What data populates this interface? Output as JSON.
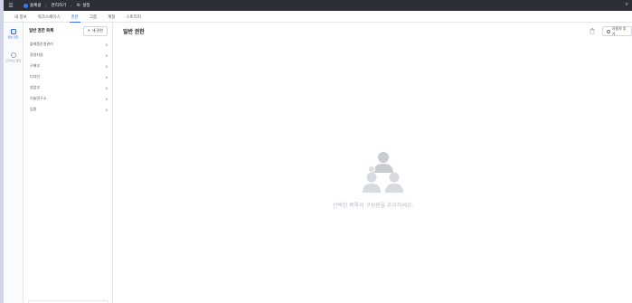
{
  "topbar": {
    "menu_icon": "hamburger-icon",
    "app_name": "올체클",
    "breadcrumb": [
      "관리하기",
      "설정"
    ],
    "right_icon": "search-icon"
  },
  "tabs": [
    {
      "label": "내 정보",
      "active": false
    },
    {
      "label": "워크스페이스",
      "active": false
    },
    {
      "label": "권한",
      "active": true
    },
    {
      "label": "그룹",
      "active": false
    },
    {
      "label": "계정",
      "active": false
    },
    {
      "label": "스토리지",
      "active": false
    }
  ],
  "rail": [
    {
      "label": "일반 권한",
      "icon": "user-shield-icon",
      "active": true
    },
    {
      "label": "드라이브 권한",
      "icon": "drive-icon",
      "active": false
    }
  ],
  "list_panel": {
    "title": "일반 권한 목록",
    "new_button": "새 권한",
    "items": [
      {
        "label": "플래폼운영관리",
        "count": "0"
      },
      {
        "label": "경영지원",
        "count": "0"
      },
      {
        "label": "구매부",
        "count": "0"
      },
      {
        "label": "디자인",
        "count": "0"
      },
      {
        "label": "영업부",
        "count": "0"
      },
      {
        "label": "기술연구소",
        "count": "0"
      },
      {
        "label": "임원",
        "count": "0"
      }
    ]
  },
  "main": {
    "title": "일반 권한",
    "add_user_button": "사용자 추가",
    "empty_message": "선택된 목록의 구성원을 추가하세요."
  },
  "colors": {
    "accent": "#2f6df6",
    "topbar": "#2c2f36",
    "placeholder": "#b9bcc2"
  }
}
